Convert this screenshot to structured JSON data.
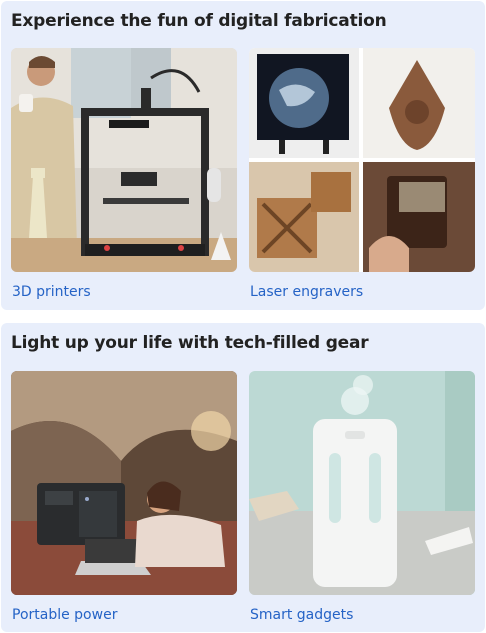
{
  "sections": [
    {
      "title": "Experience the fun of digital fabrication",
      "tiles": [
        {
          "label": "3D printers"
        },
        {
          "label": "Laser engravers"
        }
      ]
    },
    {
      "title": "Light up your life with tech-filled gear",
      "tiles": [
        {
          "label": "Portable power"
        },
        {
          "label": "Smart gadgets"
        }
      ]
    }
  ],
  "colors": {
    "card_background": "#e8eefb",
    "link_text": "#2563c6",
    "title_text": "#222222"
  }
}
